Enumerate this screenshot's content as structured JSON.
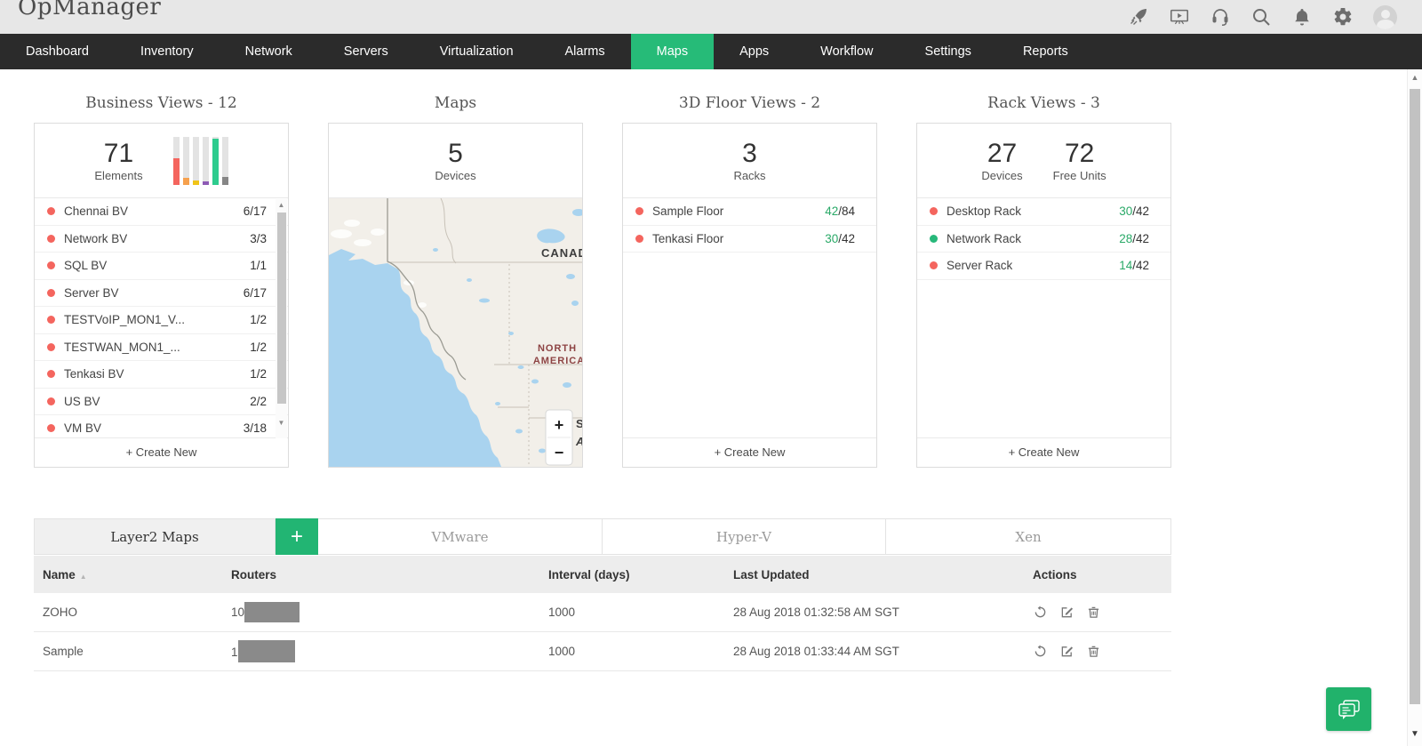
{
  "header": {
    "logo": "OpManager",
    "icons": [
      "rocket-icon",
      "video-tutorial-icon",
      "support-headset-icon",
      "search-icon",
      "notifications-bell-icon",
      "settings-gear-icon",
      "user-avatar"
    ]
  },
  "nav": {
    "items": [
      {
        "label": "Dashboard",
        "active": false
      },
      {
        "label": "Inventory",
        "active": false
      },
      {
        "label": "Network",
        "active": false
      },
      {
        "label": "Servers",
        "active": false
      },
      {
        "label": "Virtualization",
        "active": false
      },
      {
        "label": "Alarms",
        "active": false
      },
      {
        "label": "Maps",
        "active": true
      },
      {
        "label": "Apps",
        "active": false
      },
      {
        "label": "Workflow",
        "active": false
      },
      {
        "label": "Settings",
        "active": false
      },
      {
        "label": "Reports",
        "active": false
      }
    ],
    "active_color": "#26bb78"
  },
  "cards": {
    "business": {
      "title": "Business Views - 12",
      "stat": {
        "value": "71",
        "label": "Elements"
      },
      "bars": [
        {
          "height": 55,
          "color": "#f4655e"
        },
        {
          "height": 13,
          "color": "#f6a14e"
        },
        {
          "height": 9,
          "color": "#f0c419"
        },
        {
          "height": 7,
          "color": "#8e5bb5"
        },
        {
          "height": 96,
          "color": "#2ecc8e"
        },
        {
          "height": 16,
          "color": "#868686"
        }
      ],
      "items": [
        {
          "name": "Chennai BV",
          "value": "6/17",
          "status": "red"
        },
        {
          "name": "Network BV",
          "value": "3/3",
          "status": "red"
        },
        {
          "name": "SQL BV",
          "value": "1/1",
          "status": "red"
        },
        {
          "name": "Server BV",
          "value": "6/17",
          "status": "red"
        },
        {
          "name": "TESTVoIP_MON1_V...",
          "value": "1/2",
          "status": "red"
        },
        {
          "name": "TESTWAN_MON1_...",
          "value": "1/2",
          "status": "red"
        },
        {
          "name": "Tenkasi BV",
          "value": "1/2",
          "status": "red"
        },
        {
          "name": "US BV",
          "value": "2/2",
          "status": "red"
        },
        {
          "name": "VM BV",
          "value": "3/18",
          "status": "red"
        }
      ],
      "create_new": "+ Create New"
    },
    "maps": {
      "title": "Maps",
      "stat": {
        "value": "5",
        "label": "Devices"
      },
      "labels": {
        "country": "CANADA",
        "region_line1": "NORTH",
        "region_line2": "AMERICA",
        "fragment1": "S",
        "fragment2": "A"
      },
      "zoom_in": "+",
      "zoom_out": "−",
      "colors": {
        "land": "#f2efe9",
        "water": "#a9d3ef",
        "region_text": "#8d4343"
      }
    },
    "floor": {
      "title": "3D Floor Views - 2",
      "stat": {
        "value": "3",
        "label": "Racks"
      },
      "items": [
        {
          "name": "Sample Floor",
          "used": "42",
          "total": "/84",
          "status": "red"
        },
        {
          "name": "Tenkasi Floor",
          "used": "30",
          "total": "/42",
          "status": "red"
        }
      ],
      "create_new": "+ Create New"
    },
    "rack": {
      "title": "Rack Views - 3",
      "stats": [
        {
          "value": "27",
          "label": "Devices"
        },
        {
          "value": "72",
          "label": "Free Units"
        }
      ],
      "items": [
        {
          "name": "Desktop Rack",
          "used": "30",
          "total": "/42",
          "status": "red"
        },
        {
          "name": "Network Rack",
          "used": "28",
          "total": "/42",
          "status": "green"
        },
        {
          "name": "Server Rack",
          "used": "14",
          "total": "/42",
          "status": "red"
        }
      ],
      "create_new": "+ Create New"
    }
  },
  "bottom": {
    "tabs": [
      {
        "label": "Layer2 Maps",
        "active": true
      },
      {
        "label": "VMware",
        "active": false
      },
      {
        "label": "Hyper-V",
        "active": false
      },
      {
        "label": "Xen",
        "active": false
      }
    ],
    "add_button": "+",
    "table": {
      "columns": [
        "Name",
        "Routers",
        "Interval (days)",
        "Last Updated",
        "Actions"
      ],
      "rows": [
        {
          "name": "ZOHO",
          "router_prefix": "10",
          "router_redacted": true,
          "interval": "1000",
          "last_updated": "28 Aug 2018 01:32:58 AM SGT"
        },
        {
          "name": "Sample",
          "router_prefix": "1",
          "router_redacted": true,
          "interval": "1000",
          "last_updated": "28 Aug 2018 01:33:44 AM SGT"
        }
      ],
      "row_actions": [
        "refresh-icon",
        "edit-icon",
        "delete-icon"
      ]
    }
  },
  "misc": {
    "chat_button": "live-chat",
    "accent_green": "#22b573",
    "status_red": "#f4655e",
    "status_green": "#27b87a"
  }
}
